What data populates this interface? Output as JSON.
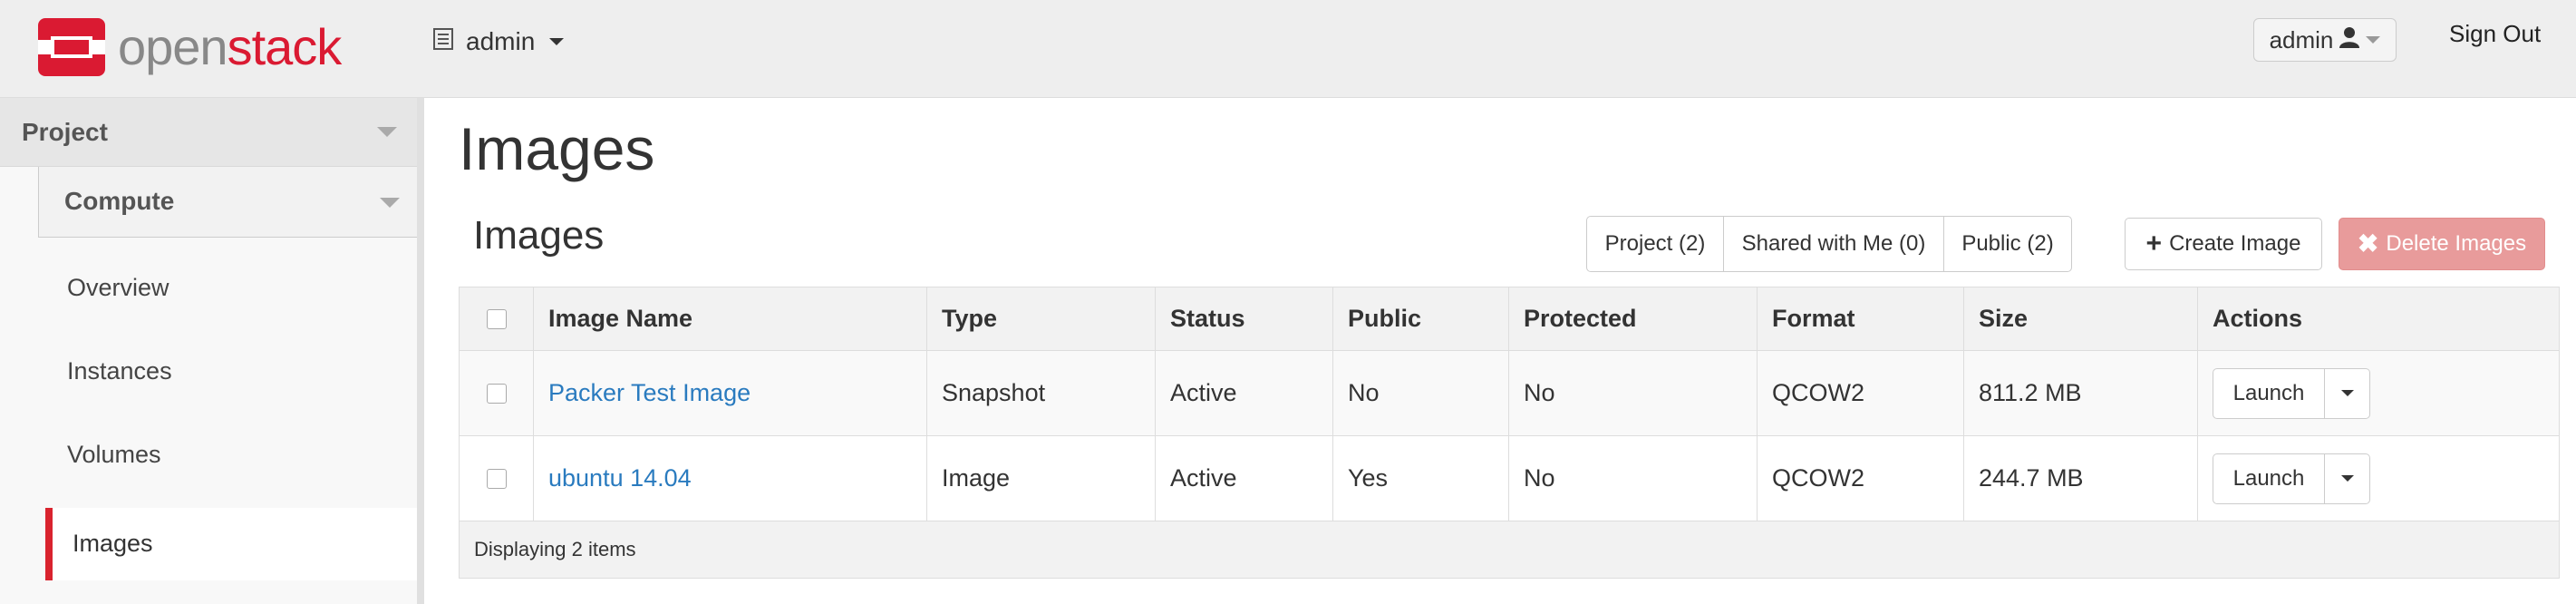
{
  "brand": {
    "logo_open": "open",
    "logo_stack": "stack",
    "logo_icon": "openstack-logo-icon"
  },
  "topnav": {
    "project_label": "admin",
    "project_icon": "document-list-icon",
    "user_label": "admin",
    "user_icon": "user-icon",
    "signout_label": "Sign Out"
  },
  "sidebar": {
    "dashboard_label": "Project",
    "panel_group_label": "Compute",
    "items": [
      {
        "label": "Overview"
      },
      {
        "label": "Instances"
      },
      {
        "label": "Volumes"
      },
      {
        "label": "Images",
        "active": true
      }
    ]
  },
  "main": {
    "page_title": "Images",
    "section_title": "Images",
    "filters": [
      {
        "label": "Project (2)"
      },
      {
        "label": "Shared with Me (0)"
      },
      {
        "label": "Public (2)"
      }
    ],
    "create_label": "Create Image",
    "delete_label": "Delete Images",
    "colors": {
      "link": "#2a7bbf",
      "danger": "#e89b9b",
      "brand": "#da1a32"
    }
  },
  "table": {
    "columns": [
      "Image Name",
      "Type",
      "Status",
      "Public",
      "Protected",
      "Format",
      "Size",
      "Actions"
    ],
    "rows": [
      {
        "name": "Packer Test Image",
        "type": "Snapshot",
        "status": "Active",
        "public": "No",
        "protected": "No",
        "format": "QCOW2",
        "size": "811.2 MB",
        "action": "Launch"
      },
      {
        "name": "ubuntu 14.04",
        "type": "Image",
        "status": "Active",
        "public": "Yes",
        "protected": "No",
        "format": "QCOW2",
        "size": "244.7 MB",
        "action": "Launch"
      }
    ],
    "footer": "Displaying 2 items"
  }
}
